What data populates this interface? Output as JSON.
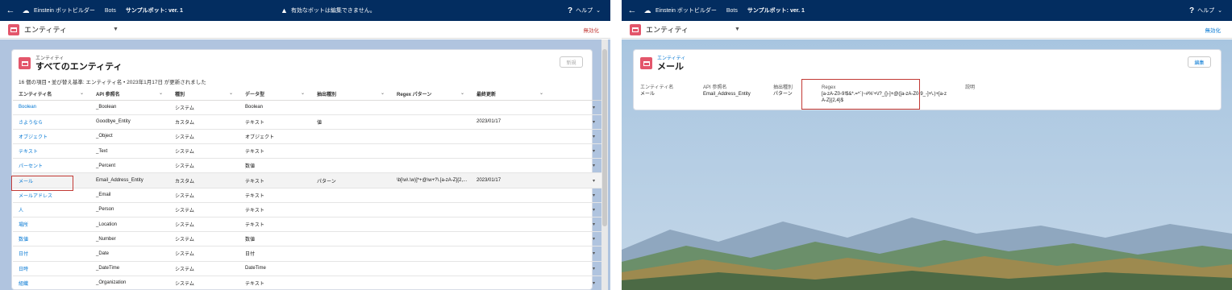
{
  "app": {
    "back_glyph": "←",
    "app_name": "Einstein ボットビルダー",
    "nav_tab": "Bots",
    "bot_name": "サンプルボット: ver. 1",
    "warning": "有効なボットは編集できません。",
    "help": "ヘルプ"
  },
  "subbar": {
    "title": "エンティティ",
    "left_action": "無効化",
    "right_action": "無効化"
  },
  "list": {
    "eyebrow": "エンティティ",
    "title": "すべてのエンティティ",
    "new_button": "新規",
    "meta": "16 個の項目 • 並び替え基準: エンティティ名 • 2023年1月17日 が更新されました",
    "columns": [
      "エンティティ名",
      "API 参照名",
      "種別",
      "データ型",
      "抽出種別",
      "Regex パターン",
      "最終更新"
    ],
    "rows": [
      [
        "Boolean",
        "_Boolean",
        "システム",
        "Boolean",
        "",
        "",
        ""
      ],
      [
        "さようなら",
        "Goodbye_Entity",
        "カスタム",
        "テキスト",
        "値",
        "",
        "2023/01/17"
      ],
      [
        "オブジェクト",
        "_Object",
        "システム",
        "オブジェクト",
        "",
        "",
        ""
      ],
      [
        "テキスト",
        "_Text",
        "システム",
        "テキスト",
        "",
        "",
        ""
      ],
      [
        "パーセント",
        "_Percent",
        "システム",
        "数値",
        "",
        "",
        ""
      ],
      [
        "メール",
        "Email_Address_Entity",
        "カスタム",
        "テキスト",
        "パターン",
        "\\b[\\w\\.\\w)]*+@\\w+?\\.[a-zA-Z]{2,...",
        "2023/01/17"
      ],
      [
        "メールアドレス",
        "_Email",
        "システム",
        "テキスト",
        "",
        "",
        ""
      ],
      [
        "人",
        "_Person",
        "システム",
        "テキスト",
        "",
        "",
        ""
      ],
      [
        "場所",
        "_Location",
        "システム",
        "テキスト",
        "",
        "",
        ""
      ],
      [
        "数値",
        "_Number",
        "システム",
        "数値",
        "",
        "",
        ""
      ],
      [
        "日付",
        "_Date",
        "システム",
        "日付",
        "",
        "",
        ""
      ],
      [
        "日時",
        "_DateTime",
        "システム",
        "DateTime",
        "",
        "",
        ""
      ],
      [
        "組織",
        "_Organization",
        "システム",
        "テキスト",
        "",
        "",
        ""
      ]
    ]
  },
  "detail": {
    "eyebrow": "エンティティ",
    "title": "メール",
    "edit_button": "編集",
    "fields": [
      {
        "label": "エンティティ名",
        "value": "メール"
      },
      {
        "label": "API 参照名",
        "value": "Email_Address_Entity"
      },
      {
        "label": "抽出種別",
        "value": "パターン"
      },
      {
        "label": "Regex",
        "value": "[a-zA-Z0-9!$&*.=^`|~#%'+\\/?_{}-]+@([a-zA-Z0-9_-]+\\.)+[a-zA-Z]{2,4}$"
      },
      {
        "label": "説明",
        "value": ""
      }
    ]
  }
}
